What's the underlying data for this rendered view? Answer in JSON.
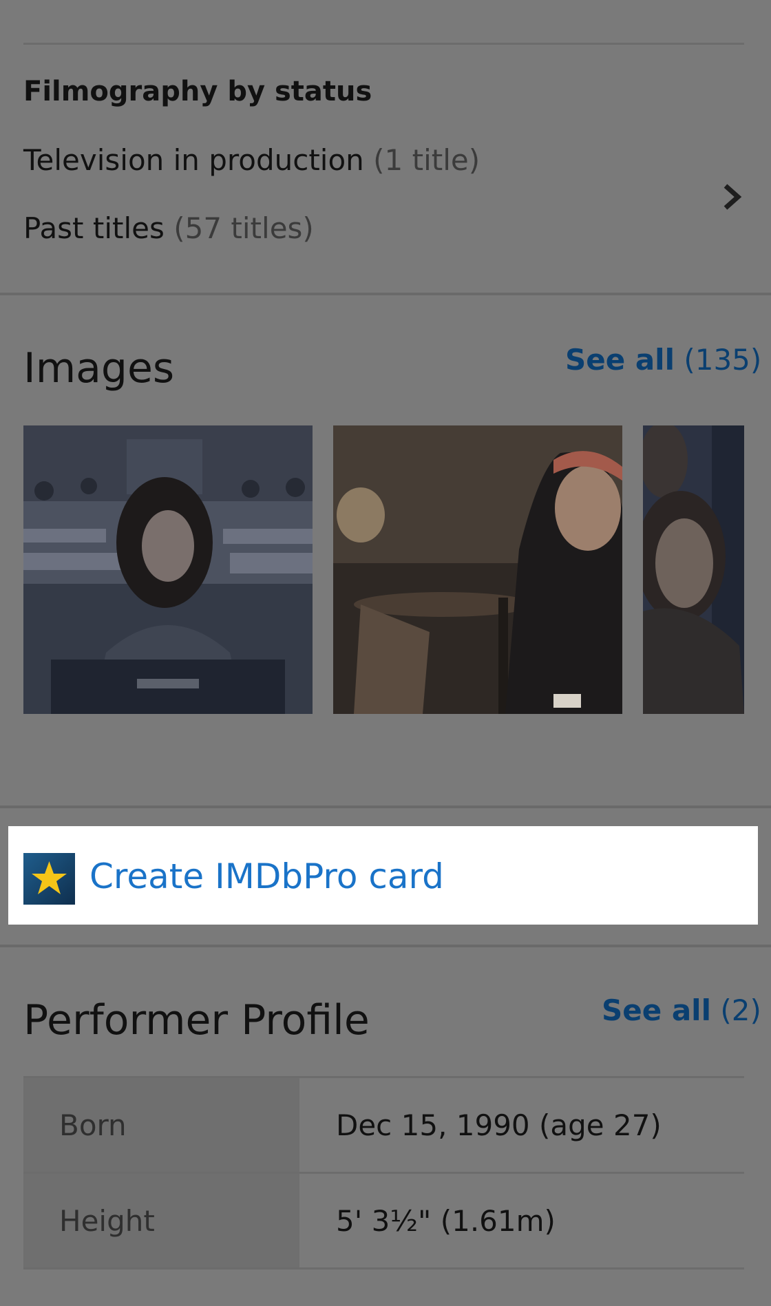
{
  "filmography": {
    "title": "Filmography by status",
    "rows": [
      {
        "label": "Television in production",
        "count": "(1 title)"
      },
      {
        "label": "Past titles",
        "count": "(57 titles)"
      }
    ]
  },
  "images": {
    "title": "Images",
    "see_all": "See all",
    "count": "(135)"
  },
  "imdbpro": {
    "label": "Create IMDbPro card",
    "icon": "star-logo-icon"
  },
  "profile": {
    "title": "Performer Profile",
    "see_all": "See all",
    "count": "(2)",
    "rows": [
      {
        "key": "Born",
        "value": "Dec 15, 1990 (age 27)"
      },
      {
        "key": "Height",
        "value": "5' 3½\" (1.61m)"
      }
    ]
  },
  "colors": {
    "overlay_bg": "#7a7a7a",
    "link_dark": "#0a3f70",
    "link_bright": "#1a73c8"
  }
}
